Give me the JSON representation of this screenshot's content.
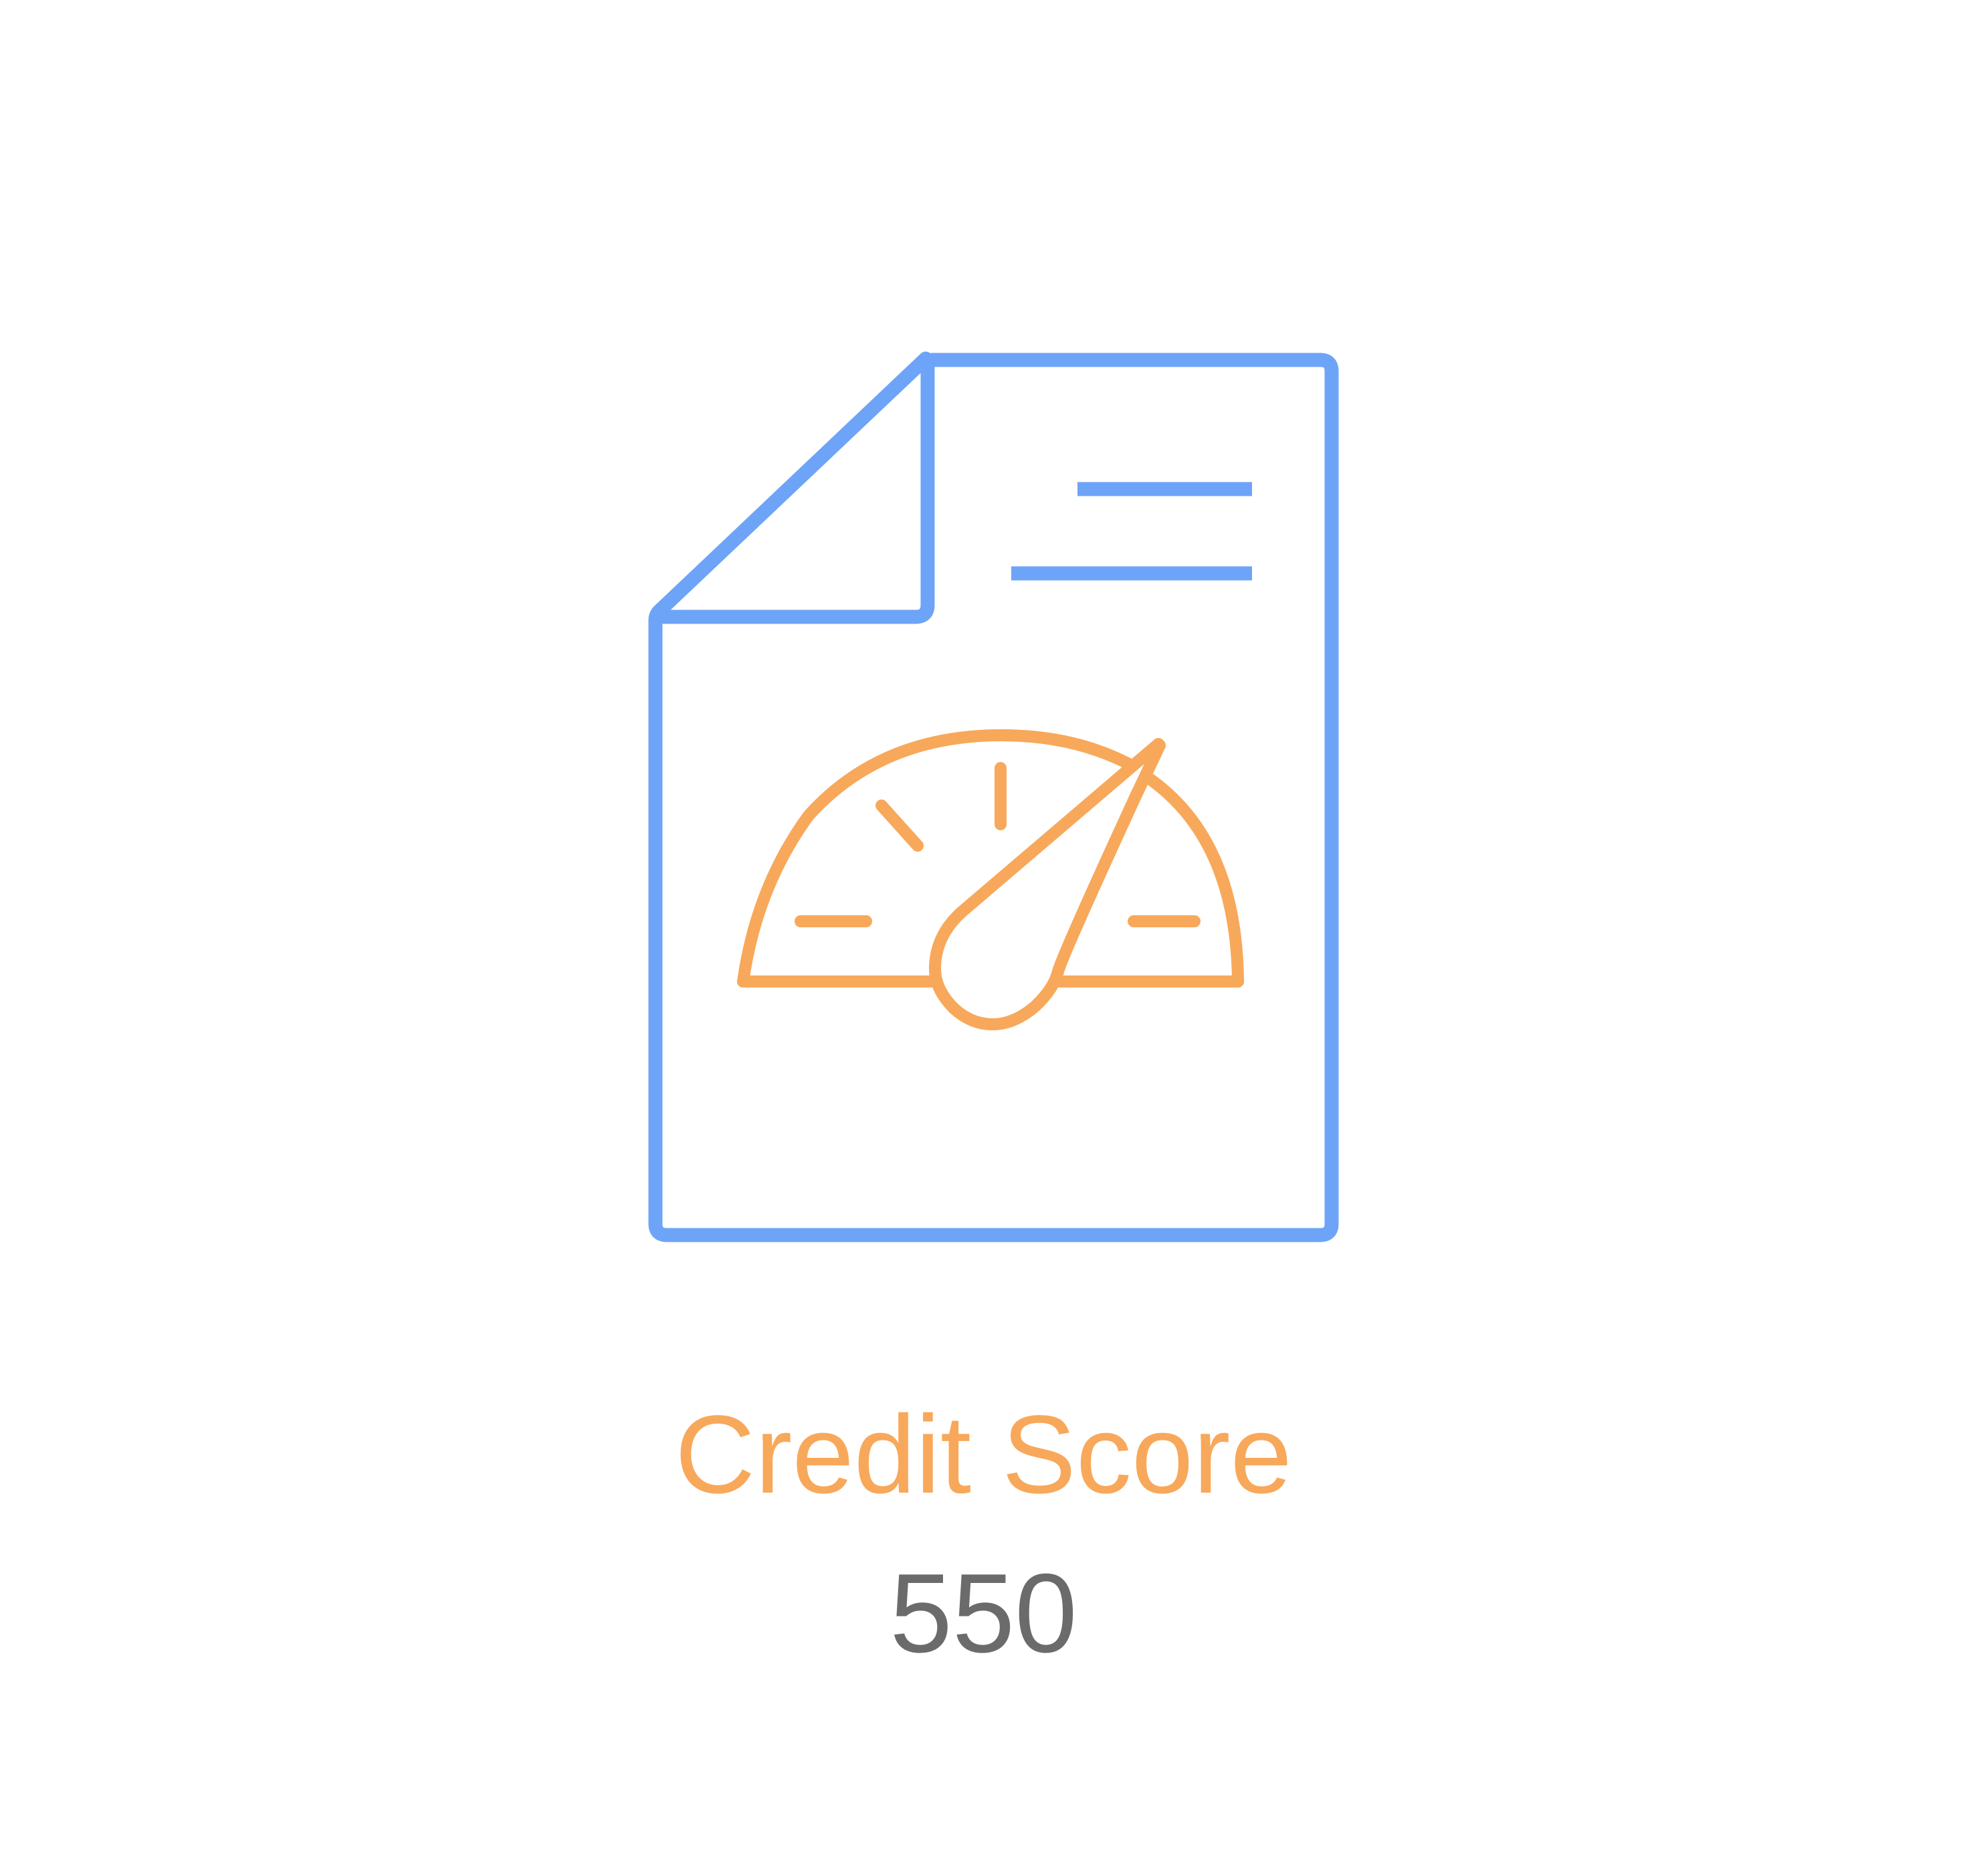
{
  "icon": {
    "name": "credit-report-gauge-icon",
    "document_color": "#6ea4f7",
    "gauge_color": "#f8a85a"
  },
  "title": "Credit Score",
  "score": "550",
  "colors": {
    "title": "#f8a85a",
    "score": "#6b6b6b",
    "background": "#ffffff"
  }
}
